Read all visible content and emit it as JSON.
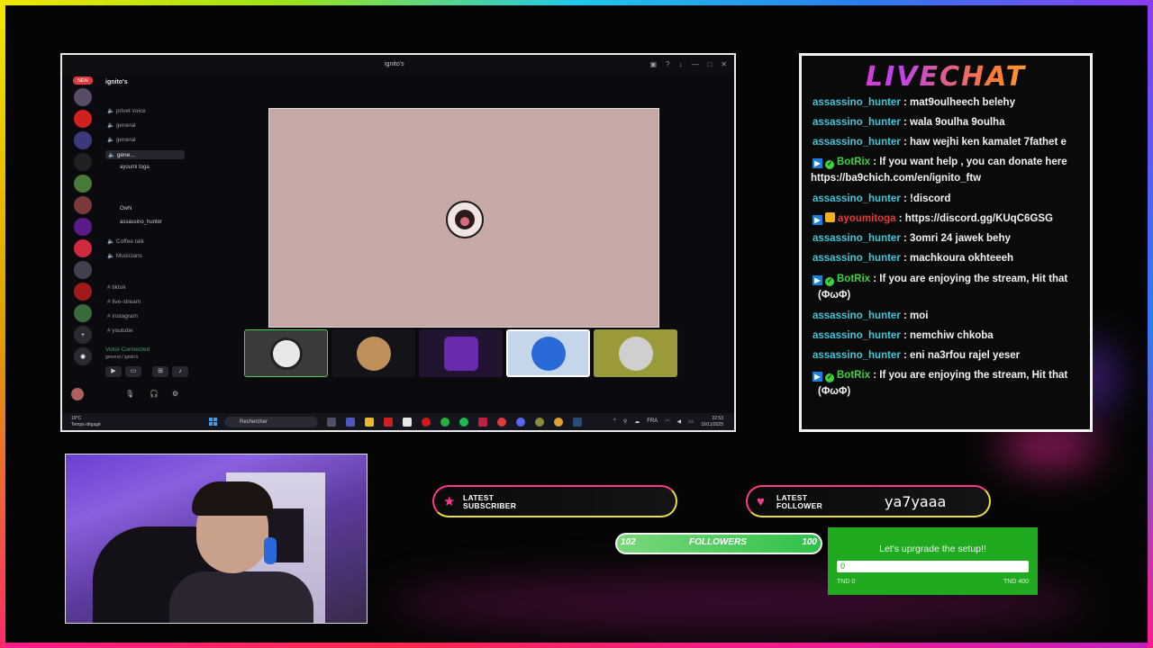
{
  "discord": {
    "window_title": "ignito's",
    "server_name": "ignito's",
    "new_badge": "NEW",
    "channels": [
      "privet voice",
      "general",
      "general",
      "gene...",
      "Coffee talk",
      "Musicians",
      "tiktok",
      "live-stream",
      "instagram",
      "youtube"
    ],
    "voice_users": [
      "ayoumi toga",
      "OwN",
      "assassino_hunter"
    ],
    "voice_status": "Voice Connected",
    "voice_sub": "general / ignito's",
    "taskbar": {
      "search_placeholder": "Rechercher",
      "weather_temp": "19°C",
      "weather_desc": "Temps dégagé",
      "lang": "FRA",
      "time": "22:53",
      "date": "16/11/2025"
    }
  },
  "livechat": {
    "title": "LIVECHAT",
    "messages": [
      {
        "user": "assassino_hunter",
        "text": " : mat9oulheech belehy"
      },
      {
        "user": "assassino_hunter",
        "text": " : wala 9oulha 9oulha"
      },
      {
        "user": "assassino_hunter",
        "text": " : haw wejhi ken kamalet 7fathet e"
      },
      {
        "user": "BotRix",
        "text": " : If you want help , you can donate here",
        "cont": "https://ba9chich.com/en/ignito_ftw"
      },
      {
        "user": "assassino_hunter",
        "text": " : !discord"
      },
      {
        "user": "ayoumitoga",
        "text": " : https://discord.gg/KUqC6GSG"
      },
      {
        "user": "assassino_hunter",
        "text": " : 3omri 24 jawek behy"
      },
      {
        "user": "assassino_hunter",
        "text": " : machkoura okhteeeh"
      },
      {
        "user": "BotRix",
        "text": " : If you are enjoying the stream, Hit that",
        "cont": "(ΦωΦ)"
      },
      {
        "user": "assassino_hunter",
        "text": " : moi"
      },
      {
        "user": "assassino_hunter",
        "text": " : nemchiw chkoba"
      },
      {
        "user": "assassino_hunter",
        "text": " : eni na3rfou rajel yeser"
      },
      {
        "user": "BotRix",
        "text": " : If you are enjoying the stream, Hit that",
        "cont": "(ΦωΦ)"
      }
    ]
  },
  "alerts": {
    "latest_subscriber_label": "LATEST SUBSCRIBER",
    "latest_subscriber_value": "",
    "latest_follower_label": "LATEST FOLLOWER",
    "latest_follower_value": "ya7yaaa"
  },
  "followers_goal": {
    "current": "102",
    "label": "FOLLOWERS",
    "target": "100",
    "progress": 1.0
  },
  "donation_goal": {
    "title": "Let's uprgrade the setup!!",
    "current": "0",
    "min_label": "TND 0",
    "max_label": "TND 400",
    "progress": 0
  },
  "colors": {
    "chat_user": "#3fc6d8",
    "chat_bot": "#3fd23f",
    "goal_bg": "#1faa1f",
    "accent_pink": "#ff3a8a"
  }
}
